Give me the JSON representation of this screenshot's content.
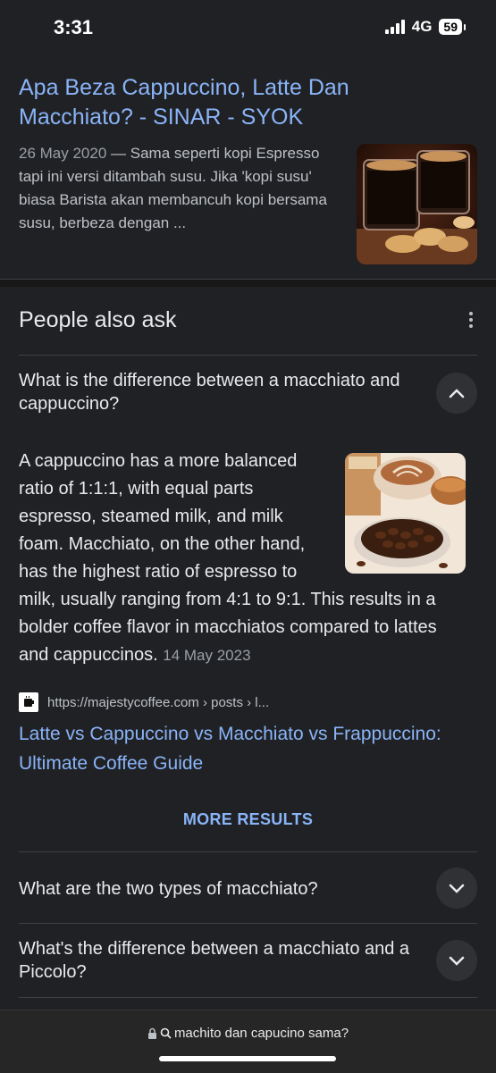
{
  "status_bar": {
    "time": "3:31",
    "network": "4G",
    "battery": "59"
  },
  "search_result": {
    "title": "Apa Beza Cappuccino, Latte Dan Macchiato? - SINAR - SYOK",
    "date": "26 May 2020",
    "separator": " — ",
    "snippet": "Sama seperti kopi Espresso tapi ini versi ditambah susu. Jika 'kopi susu' biasa Barista akan membancuh kopi bersama susu, berbeza dengan ..."
  },
  "people_also_ask": {
    "heading": "People also ask",
    "expanded": {
      "question": "What is the difference between a macchiato and cappuccino?",
      "answer": "A cappuccino has a more balanced ratio of 1:1:1, with equal parts espresso, steamed milk, and milk foam. Macchiato, on the other hand, has the highest ratio of espresso to milk, usually ranging from 4:1 to 9:1. This results in a bolder coffee flavor in macchiatos compared to lattes and cappuccinos.",
      "date": "14 May 2023",
      "source_url": "https://majestycoffee.com › posts › l...",
      "source_title": "Latte vs Cappuccino vs Macchiato vs Frappuccino: Ultimate Coffee Guide"
    },
    "more_results_label": "MORE RESULTS",
    "questions": [
      "What are the two types of macchiato?",
      "What's the difference between a macchiato and a Piccolo?"
    ]
  },
  "address_bar": {
    "query": "machito dan capucino sama?"
  },
  "colors": {
    "link": "#8ab4f8",
    "background": "#202124",
    "text": "#e8eaed"
  }
}
